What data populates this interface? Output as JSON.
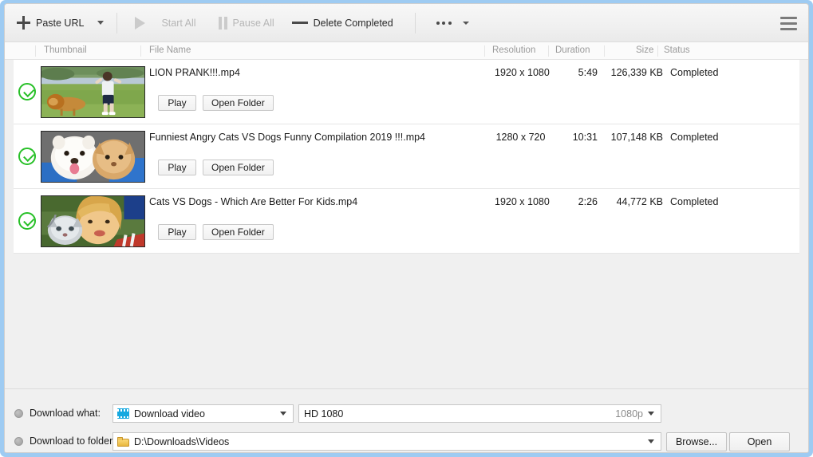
{
  "toolbar": {
    "paste_url": "Paste URL",
    "start_all": "Start All",
    "pause_all": "Pause All",
    "delete_completed": "Delete Completed",
    "menu_icon": "hamburger-icon",
    "more_icon": "ellipsis-icon"
  },
  "list": {
    "headers": {
      "thumbnail": "Thumbnail",
      "file_name": "File Name",
      "resolution": "Resolution",
      "duration": "Duration",
      "size": "Size",
      "status": "Status"
    },
    "row_actions": {
      "play": "Play",
      "open_folder": "Open Folder"
    },
    "rows": [
      {
        "file_name": "LION PRANK!!!.mp4",
        "resolution": "1920 x 1080",
        "duration": "5:49",
        "size": "126,339 KB",
        "status": "Completed",
        "status_icon": "check-circle-icon",
        "play": "Play",
        "open_folder": "Open Folder"
      },
      {
        "file_name": "Funniest Angry Cats VS Dogs Funny Compilation 2019 !!!.mp4",
        "resolution": "1280 x 720",
        "duration": "10:31",
        "size": "107,148 KB",
        "status": "Completed",
        "status_icon": "check-circle-icon",
        "play": "Play",
        "open_folder": "Open Folder"
      },
      {
        "file_name": "Cats VS Dogs - Which Are Better For Kids.mp4",
        "resolution": "1920 x 1080",
        "duration": "2:26",
        "size": "44,772 KB",
        "status": "Completed",
        "status_icon": "check-circle-icon",
        "play": "Play",
        "open_folder": "Open Folder"
      }
    ]
  },
  "bottom": {
    "download_what_label": "Download what:",
    "download_what_value": "Download video",
    "download_what_icon": "film-strip-icon",
    "quality_value": "HD 1080",
    "quality_suffix": "1080p",
    "download_to_label": "Download to folder:",
    "folder_value": "D:\\Downloads\\Videos",
    "folder_icon": "folder-icon",
    "browse": "Browse...",
    "open": "Open"
  },
  "colors": {
    "window_border": "#9ecbf2",
    "accent": "#17a9e0",
    "status_ok": "#28c028",
    "toolbar_bg": "#f0f0f0"
  }
}
